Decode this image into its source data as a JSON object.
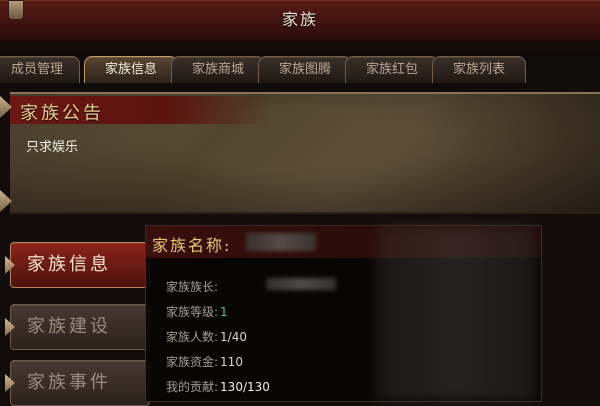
{
  "window": {
    "title": "家族"
  },
  "tabs": [
    {
      "label": "成员管理",
      "active": false
    },
    {
      "label": "家族信息",
      "active": true
    },
    {
      "label": "家族商城",
      "active": false
    },
    {
      "label": "家族图腾",
      "active": false
    },
    {
      "label": "家族红包",
      "active": false
    },
    {
      "label": "家族列表",
      "active": false
    }
  ],
  "notice": {
    "title": "家族公告",
    "content": "只求娱乐"
  },
  "menu": [
    {
      "label": "家族信息",
      "active": true
    },
    {
      "label": "家族建设",
      "active": false
    },
    {
      "label": "家族事件",
      "active": false
    }
  ],
  "info": {
    "name_label": "家族名称:",
    "stats": [
      {
        "label": "家族族长:",
        "value": ""
      },
      {
        "label": "家族等级:",
        "value": "1"
      },
      {
        "label": "家族人数:",
        "value": "1/40"
      },
      {
        "label": "家族资金:",
        "value": "110"
      },
      {
        "label": "我的贡献:",
        "value": "130/130"
      }
    ]
  },
  "colors": {
    "title_bar": "#5a1c16",
    "accent_gold": "#e8c770",
    "active_red": "#8a241b",
    "level_green": "#4fd04a"
  }
}
